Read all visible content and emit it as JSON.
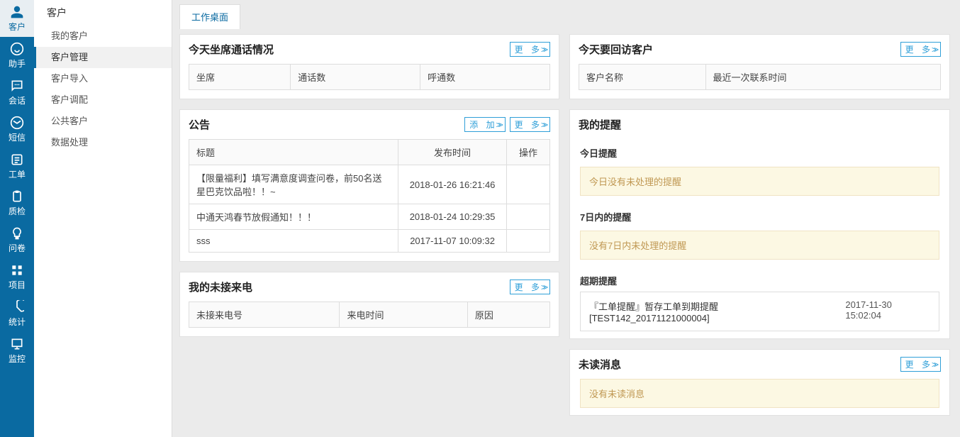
{
  "nav_main": [
    {
      "label": "客户",
      "icon": "user"
    },
    {
      "label": "助手",
      "icon": "assistant"
    },
    {
      "label": "会话",
      "icon": "chat"
    },
    {
      "label": "短信",
      "icon": "mail"
    },
    {
      "label": "工单",
      "icon": "list"
    },
    {
      "label": "质检",
      "icon": "clipboard"
    },
    {
      "label": "问卷",
      "icon": "bulb"
    },
    {
      "label": "项目",
      "icon": "grid"
    },
    {
      "label": "统计",
      "icon": "pie"
    },
    {
      "label": "监控",
      "icon": "monitor"
    }
  ],
  "nav_sub": {
    "title": "客户",
    "items": [
      "我的客户",
      "客户管理",
      "客户导入",
      "客户调配",
      "公共客户",
      "数据处理"
    ],
    "active": 1
  },
  "tabs": [
    "工作桌面"
  ],
  "btn": {
    "more": "更 多",
    "add": "添 加",
    "arrows": ">>"
  },
  "panel_agent": {
    "title": "今天坐席通话情况",
    "headers": [
      "坐席",
      "通话数",
      "呼通数"
    ]
  },
  "panel_announce": {
    "title": "公告",
    "headers": [
      "标题",
      "发布时间",
      "操作"
    ],
    "rows": [
      {
        "title": "【限量福利】填写满意度调查问卷，前50名送星巴克饮品啦！！~",
        "time": "2018-01-26 16:21:46",
        "op": ""
      },
      {
        "title": "中通天鸿春节放假通知！！！",
        "time": "2018-01-24 10:29:35",
        "op": ""
      },
      {
        "title": "sss",
        "time": "2017-11-07 10:09:32",
        "op": ""
      }
    ]
  },
  "panel_missed": {
    "title": "我的未接来电",
    "headers": [
      "未接来电号",
      "来电时间",
      "原因"
    ]
  },
  "panel_revisit": {
    "title": "今天要回访客户",
    "headers": [
      "客户名称",
      "最近一次联系时间"
    ]
  },
  "panel_remind": {
    "title": "我的提醒",
    "sections": {
      "today": {
        "label": "今日提醒",
        "empty": "今日没有未处理的提醒"
      },
      "week": {
        "label": "7日内的提醒",
        "empty": "没有7日内未处理的提醒"
      },
      "overdue": {
        "label": "超期提醒",
        "text": "『工单提醒』暂存工单到期提醒[TEST142_20171121000004]",
        "time": "2017-11-30 15:02:04"
      }
    }
  },
  "panel_unread": {
    "title": "未读消息",
    "empty": "没有未读消息"
  }
}
